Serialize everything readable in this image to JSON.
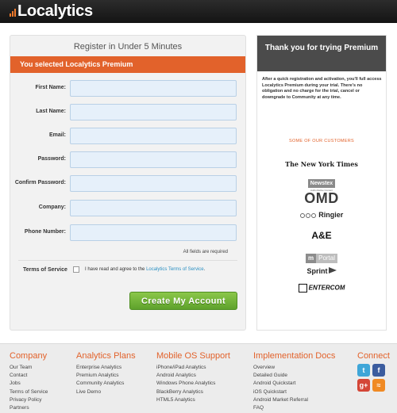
{
  "header": {
    "logo_text": "Localytics"
  },
  "form": {
    "title": "Register in Under 5 Minutes",
    "banner": "You selected Localytics Premium",
    "fields": [
      {
        "label": "First Name:",
        "value": ""
      },
      {
        "label": "Last Name:",
        "value": ""
      },
      {
        "label": "Email:",
        "value": ""
      },
      {
        "label": "Password:",
        "value": ""
      },
      {
        "label": "Confirm Password:",
        "value": ""
      },
      {
        "label": "Company:",
        "value": ""
      },
      {
        "label": "Phone Number:",
        "value": ""
      }
    ],
    "required_note": "All fields are required",
    "tos_label": "Terms of Service",
    "tos_text": "I have read and agree to the",
    "tos_link": "Localytics Terms of Service",
    "tos_period": ".",
    "submit_label": "Create My Account"
  },
  "side": {
    "heading": "Thank you for trying Premium",
    "text": "After a quick registration and activation, you'll full access Localytics Premium during your trial. There's no obligation and no charge for the trial, cancel or downgrade to Community at any time.",
    "customers_heading": "SOME OF OUR CUSTOMERS",
    "customers": [
      "The New York Times",
      "Newstex",
      "OMD",
      "Ringier",
      "A&E",
      "mPortal",
      "Sprint",
      "ENTERCOM"
    ],
    "newstex_tagline": "Authoritative Content"
  },
  "footer": {
    "columns": [
      {
        "title": "Company",
        "items": [
          "Our Team",
          "Contact",
          "Jobs",
          "Terms of Service",
          "Privacy Policy",
          "Partners"
        ]
      },
      {
        "title": "Analytics Plans",
        "items": [
          "Enterprise Analytics",
          "Premium Analytics",
          "Community Analytics",
          "Live Demo"
        ]
      },
      {
        "title": "Mobile OS Support",
        "items": [
          "iPhone/iPad Analytics",
          "Android Analytics",
          "Windows Phone Analytics",
          "BlackBerry Analytics",
          "HTML5 Analytics"
        ]
      },
      {
        "title": "Implementation Docs",
        "items": [
          "Overview",
          "Detailed Guide",
          "Android Quickstart",
          "iOS Quickstart",
          "Android Market Referral",
          "FAQ"
        ]
      },
      {
        "title": "Connect",
        "items": []
      }
    ],
    "social_icons": [
      "twitter-icon",
      "facebook-icon",
      "google-plus-icon",
      "rss-icon"
    ]
  },
  "colors": {
    "accent": "#e2622b",
    "button": "#6cb033",
    "input_bg": "#e6f0fa",
    "link": "#2a8fc2",
    "panel_head": "#4b4b4b"
  }
}
